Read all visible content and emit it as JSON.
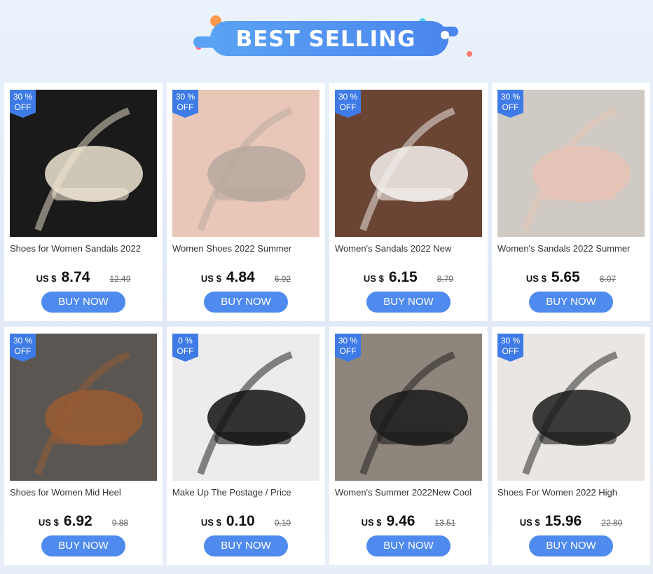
{
  "banner": {
    "title": "BEST SELLING"
  },
  "products": [
    {
      "badge_pct": "30 %",
      "badge_off": "OFF",
      "title": "Shoes for Women Sandals 2022",
      "currency": "US $",
      "price": "8.74",
      "original_price": "12.49",
      "button": "BUY NOW",
      "photo": "beige-strappy-sandals-photo",
      "bg": "#1a1a1a",
      "accent": "#efe5d2"
    },
    {
      "badge_pct": "30 %",
      "badge_off": "OFF",
      "title": "Women Shoes 2022 Summer",
      "currency": "US $",
      "price": "4.84",
      "original_price": "6.92",
      "button": "BUY NOW",
      "photo": "metallic-heeled-slides-photo",
      "bg": "#e8c7b8",
      "accent": "#b7a79d"
    },
    {
      "badge_pct": "30 %",
      "badge_off": "OFF",
      "title": "Women's Sandals 2022 New",
      "currency": "US $",
      "price": "6.15",
      "original_price": "8.79",
      "button": "BUY NOW",
      "photo": "white-block-heel-sandals-photo",
      "bg": "#6b4534",
      "accent": "#f4f1ee"
    },
    {
      "badge_pct": "30 %",
      "badge_off": "OFF",
      "title": "Women's Sandals 2022 Summer",
      "currency": "US $",
      "price": "5.65",
      "original_price": "8.07",
      "button": "BUY NOW",
      "photo": "pink-knit-sport-sandals-photo",
      "bg": "#cfcac4",
      "accent": "#e9c3b6"
    },
    {
      "badge_pct": "30 %",
      "badge_off": "OFF",
      "title": "Shoes for Women Mid Heel",
      "currency": "US $",
      "price": "6.92",
      "original_price": "9.88",
      "button": "BUY NOW",
      "photo": "woven-flats-photo",
      "bg": "#5b5652",
      "accent": "#9a5b32"
    },
    {
      "badge_pct": "0 %",
      "badge_off": "OFF",
      "title": "Make Up The Postage / Price",
      "currency": "US $",
      "price": "0.10",
      "original_price": "0.10",
      "button": "BUY NOW",
      "photo": "black-patent-pumps-photo",
      "bg": "#ececef",
      "accent": "#121212"
    },
    {
      "badge_pct": "30 %",
      "badge_off": "OFF",
      "title": "Women's Summer 2022New Cool",
      "currency": "US $",
      "price": "9.46",
      "original_price": "13.51",
      "button": "BUY NOW",
      "photo": "black-gladiator-sandals-photo",
      "bg": "#8e857c",
      "accent": "#1a1a1a"
    },
    {
      "badge_pct": "30 %",
      "badge_off": "OFF",
      "title": "Shoes For Women 2022 High",
      "currency": "US $",
      "price": "15.96",
      "original_price": "22.80",
      "button": "BUY NOW",
      "photo": "clear-strap-stiletto-photo",
      "bg": "#e9e6e3",
      "accent": "#1b1b1b"
    }
  ]
}
